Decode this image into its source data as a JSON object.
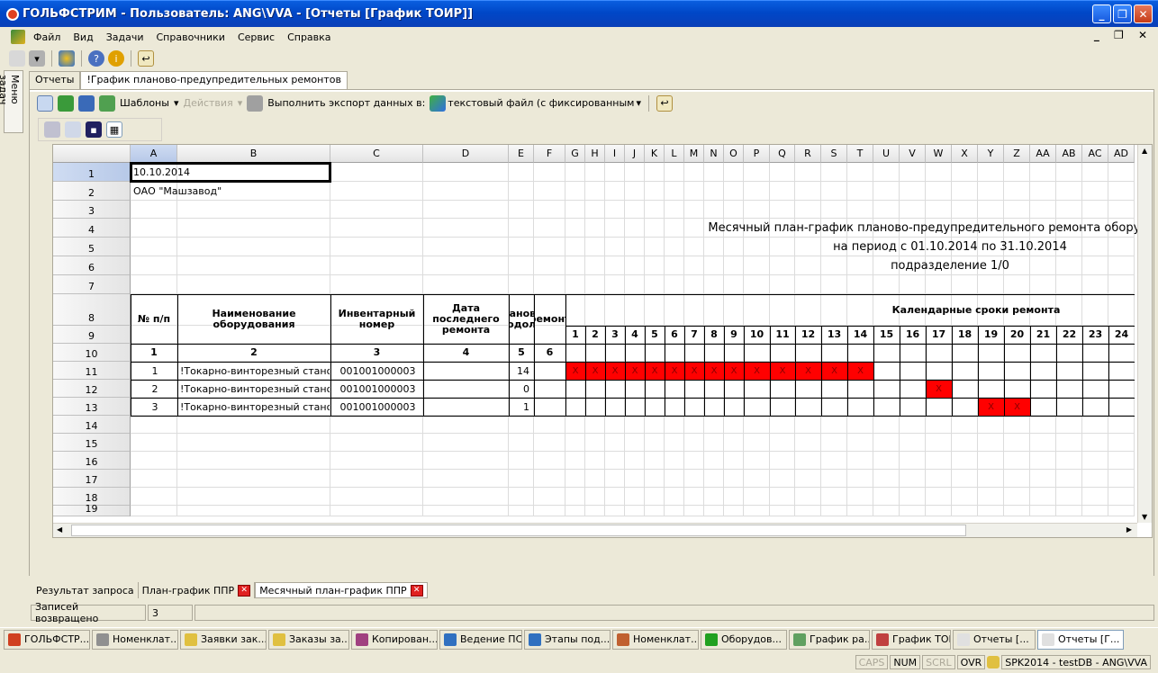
{
  "window": {
    "title": "ГОЛЬФСТРИМ - Пользователь: ANG\\VVA - [Отчеты  [График ТОИР]]"
  },
  "menu": [
    "Файл",
    "Вид",
    "Задачи",
    "Справочники",
    "Сервис",
    "Справка"
  ],
  "left_tab": "Меню задач",
  "doc_tabs": [
    "Отчеты",
    "!График планово-предупредительных ремонтов"
  ],
  "toolbar2": {
    "templates": "Шаблоны",
    "actions": "Действия",
    "export_label": "Выполнить экспорт данных в:",
    "export_value": "текстовый файл (с фиксированным"
  },
  "sheet": {
    "columns": [
      "A",
      "B",
      "C",
      "D",
      "E",
      "F",
      "G",
      "H",
      "I",
      "J",
      "K",
      "L",
      "M",
      "N",
      "O",
      "P",
      "Q",
      "R",
      "S",
      "T",
      "U",
      "V",
      "W",
      "X",
      "Y",
      "Z",
      "AA",
      "AB",
      "AC",
      "AD"
    ],
    "rows": [
      "1",
      "2",
      "3",
      "4",
      "5",
      "6",
      "7",
      "8",
      "9",
      "10",
      "11",
      "12",
      "13",
      "14",
      "15",
      "16",
      "17",
      "18",
      "19"
    ],
    "a1": "10.10.2014",
    "a2": "ОАО \"Машзавод\"",
    "title1": "Месячный план-график планово-предупредительного ремонта оборудования",
    "title2": "на период с 01.10.2014 по 31.10.2014",
    "title3": "подразделение 1/0",
    "headers": {
      "num": "№ п/п",
      "name": "Наименование оборудования",
      "inv": "Инвентарный номер",
      "date": "Дата последнего ремонта",
      "plan": "Плановая продолж.",
      "rem": "ремонт",
      "calendar": "Календарные сроки ремонта"
    },
    "header_nums": [
      "1",
      "2",
      "3",
      "4",
      "5",
      "6"
    ],
    "days": [
      "1",
      "2",
      "3",
      "4",
      "5",
      "6",
      "7",
      "8",
      "9",
      "10",
      "11",
      "12",
      "13",
      "14",
      "15",
      "16",
      "17",
      "18",
      "19",
      "20",
      "21",
      "22",
      "23",
      "24"
    ],
    "rows_data": [
      {
        "n": "1",
        "name": "!Токарно-винторезный станок",
        "inv": "001001000003",
        "plan": "14",
        "marks": [
          "1",
          "2",
          "3",
          "4",
          "5",
          "6",
          "7",
          "8",
          "9",
          "10",
          "11",
          "12",
          "13",
          "14"
        ]
      },
      {
        "n": "2",
        "name": "!Токарно-винторезный станок",
        "inv": "001001000003",
        "plan": "0",
        "marks": [
          "17"
        ]
      },
      {
        "n": "3",
        "name": "!Токарно-винторезный станок",
        "inv": "001001000003",
        "plan": "1",
        "marks": [
          "19",
          "20"
        ]
      }
    ],
    "mark_symbol": "X"
  },
  "bottom_tabs": [
    "Результат запроса",
    "План-график ППР",
    "Месячный план-график ППР"
  ],
  "status": {
    "label": "Записей возвращено",
    "value": "3"
  },
  "taskbar": [
    "ГОЛЬФСТР...",
    "Номенклат...",
    "Заявки зак...",
    "Заказы за...",
    "Копирован...",
    "Ведение ПСп",
    "Этапы под...",
    "Номенклат...",
    "Оборудов...",
    "График ра...",
    "График ТОИР",
    "Отчеты  [...",
    "Отчеты  [Г..."
  ],
  "indicators": {
    "caps": "CAPS",
    "num": "NUM",
    "scrl": "SCRL",
    "ovr": "OVR",
    "db": "SPK2014 - testDB - ANG\\VVA"
  }
}
